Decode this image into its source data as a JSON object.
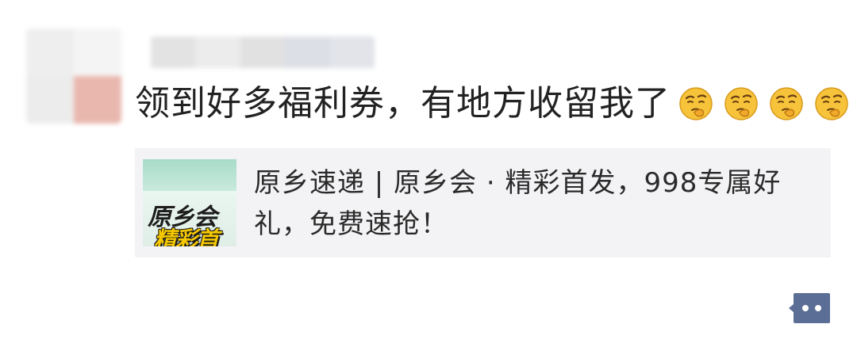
{
  "post": {
    "text": "领到好多福利券，有地方收留我了",
    "emojis": [
      "thinking-face-icon",
      "thinking-face-icon",
      "thinking-face-icon",
      "thinking-face-icon"
    ]
  },
  "link_card": {
    "title": "原乡速递 | 原乡会 · 精彩首发，998专属好礼，免费速抢！",
    "thumbnail": {
      "line1": "原乡会",
      "line2": "精彩首发"
    }
  },
  "actions": {
    "comment_icon": "comment-dots-icon"
  },
  "colors": {
    "text": "#222222",
    "card_bg": "#f3f3f5",
    "action_blue": "#5a6e96",
    "emoji_yellow": "#f6c33a"
  }
}
